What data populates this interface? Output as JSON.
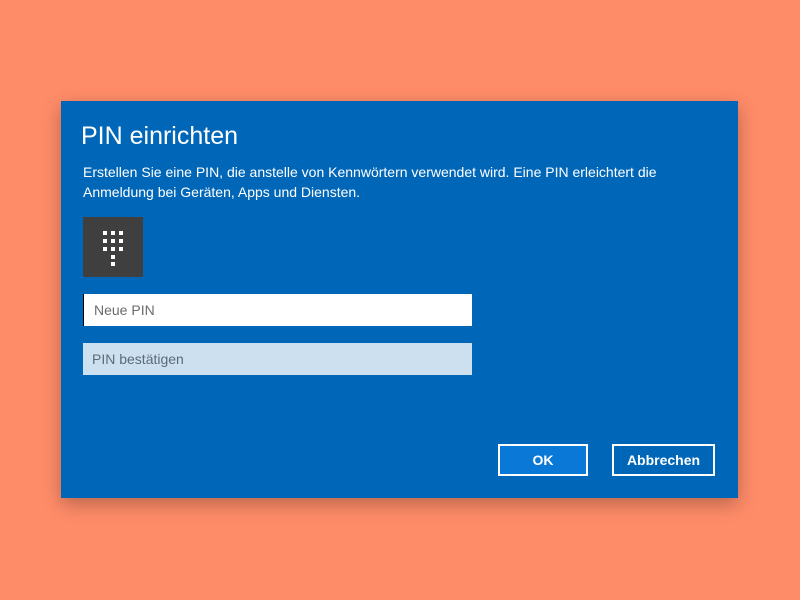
{
  "colors": {
    "backdrop": "#FF8C69",
    "dialog_background": "#0067B8",
    "keypad_tile": "#3F3F3F",
    "confirm_field": "#CCE0F0",
    "ok_button": "#0A78D7"
  },
  "dialog": {
    "title": "PIN einrichten",
    "description": "Erstellen Sie eine PIN, die anstelle von Kennwörtern verwendet wird. Eine PIN erleichtert die Anmeldung bei Geräten, Apps und Diensten.",
    "icon": "keypad-icon",
    "fields": {
      "new_pin": {
        "placeholder": "Neue PIN",
        "value": ""
      },
      "confirm_pin": {
        "placeholder": "PIN bestätigen",
        "value": ""
      }
    },
    "buttons": {
      "ok_label": "OK",
      "cancel_label": "Abbrechen"
    }
  }
}
